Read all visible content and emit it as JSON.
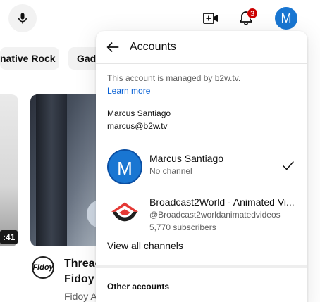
{
  "header": {
    "mic_icon": "microphone-icon",
    "create_icon": "video-plus-icon",
    "bell_icon": "bell-icon",
    "notification_count": "3",
    "avatar_letter": "M",
    "avatar_color": "#1976d2"
  },
  "chips": [
    "native Rock",
    "Gadg"
  ],
  "feed": {
    "duration": ":41",
    "video_title_line1": "Threac",
    "video_title_line2": "Fidoy I",
    "channel_logo_text": "Fidoy",
    "channel_name": "Fidoy A"
  },
  "panel": {
    "title": "Accounts",
    "managed_text": "This account is managed by b2w.tv.",
    "learn_more": "Learn more",
    "account_name": "Marcus Santiago",
    "account_email": "marcus@b2w.tv",
    "channels": [
      {
        "avatar_letter": "M",
        "name": "Marcus Santiago",
        "subtitle": "No channel",
        "selected": true
      },
      {
        "name": "Broadcast2World - Animated Vi...",
        "handle": "@Broadcast2worldanimatedvideos",
        "subscribers": "5,770 subscribers",
        "logo_icon": "broadcast2world-logo-icon"
      }
    ],
    "view_all": "View all channels",
    "other_accounts": "Other accounts"
  },
  "colors": {
    "accent_blue": "#1976d2",
    "link_blue": "#065fd4",
    "badge_red": "#cc0000",
    "logo_red": "#e53935"
  }
}
